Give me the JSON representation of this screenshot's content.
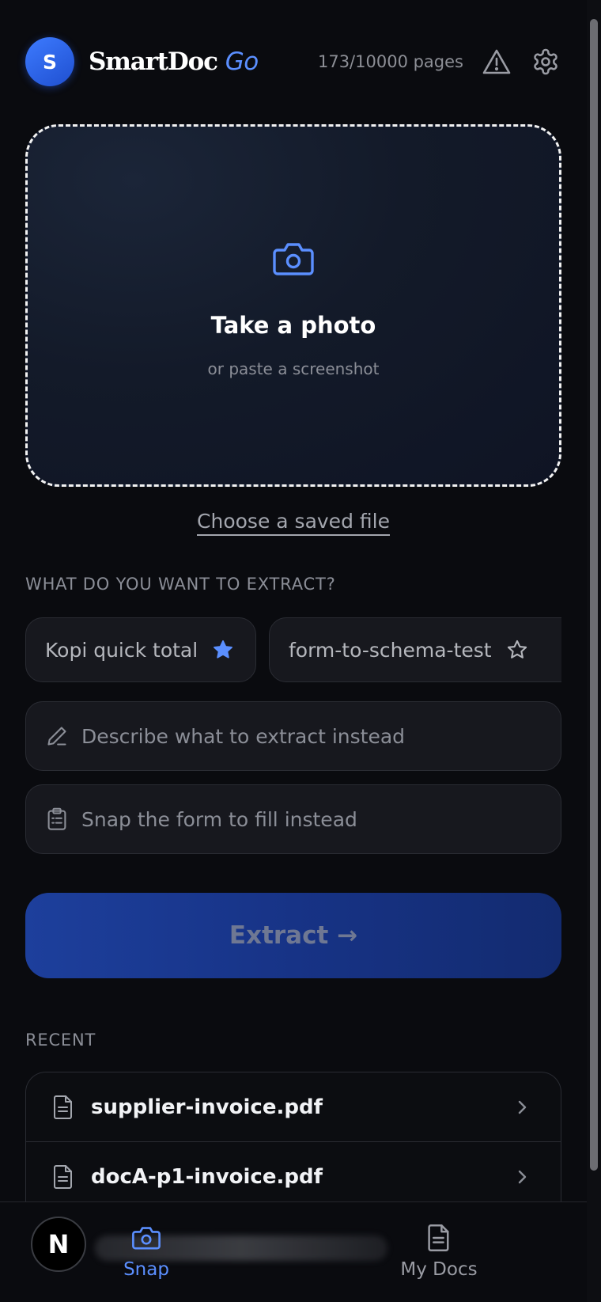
{
  "header": {
    "avatar_initial": "S",
    "brand_main": "SmartDoc",
    "brand_suffix": "Go",
    "page_usage": "173/10000 pages",
    "icons": [
      "warning-icon",
      "gear-icon"
    ]
  },
  "dropzone": {
    "icon": "camera-icon",
    "title": "Take a photo",
    "subtitle": "or paste a screenshot"
  },
  "choose_file_link": "Choose a saved file",
  "extract_section": {
    "label": "WHAT DO YOU WANT TO EXTRACT?",
    "chips": [
      {
        "label": "Kopi quick total",
        "starred": true
      },
      {
        "label": "form-to-schema-test",
        "starred": false
      }
    ],
    "describe_placeholder": "Describe what to extract instead",
    "snap_form_placeholder": "Snap the form to fill instead",
    "extract_button": "Extract →"
  },
  "recent": {
    "label": "RECENT",
    "items": [
      {
        "name": "supplier-invoice.pdf"
      },
      {
        "name": "docA-p1-invoice.pdf"
      }
    ]
  },
  "bottom_nav": {
    "badge": "N",
    "tabs": [
      {
        "label": "Snap",
        "icon": "camera-icon",
        "active": true
      },
      {
        "label": "My Docs",
        "icon": "document-icon",
        "active": false
      }
    ]
  },
  "colors": {
    "accent": "#5b8fff",
    "background": "#0a0b0f",
    "button": "#1d3f9c"
  }
}
